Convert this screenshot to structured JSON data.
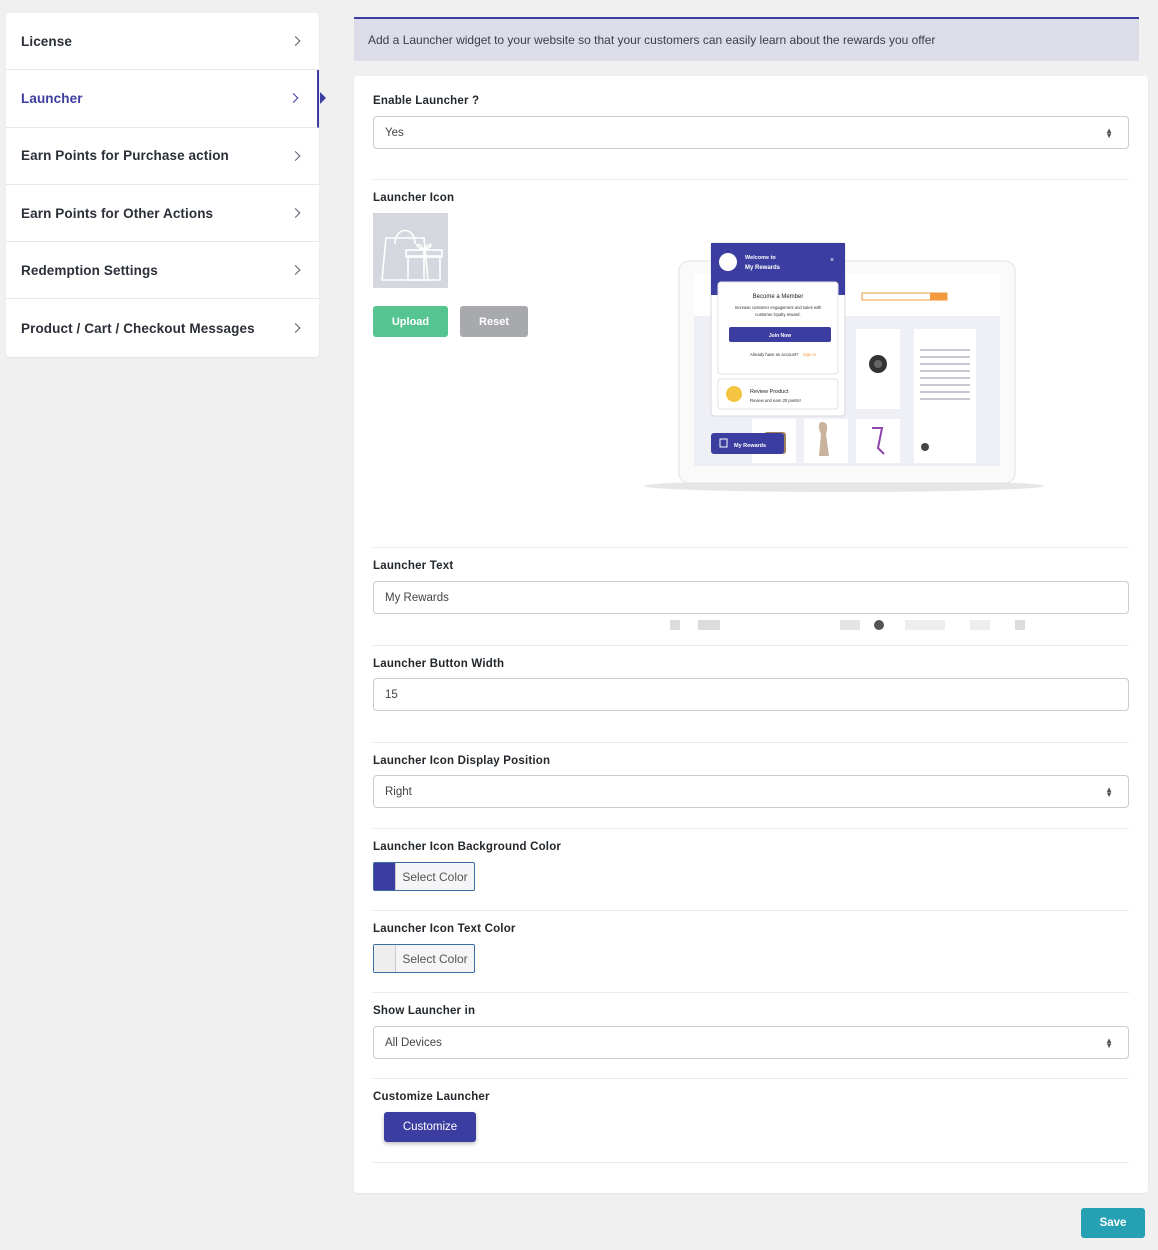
{
  "sidebar": {
    "items": [
      {
        "label": "License"
      },
      {
        "label": "Launcher"
      },
      {
        "label": "Earn Points for Purchase action"
      },
      {
        "label": "Earn Points for Other Actions"
      },
      {
        "label": "Redemption Settings"
      },
      {
        "label": "Product / Cart / Checkout Messages"
      }
    ]
  },
  "notice": "Add a Launcher widget to your website so that your customers can easily learn about the rewards you offer",
  "form": {
    "enable_launcher": {
      "label": "Enable Launcher ?",
      "value": "Yes"
    },
    "launcher_icon": {
      "label": "Launcher Icon",
      "upload_label": "Upload",
      "reset_label": "Reset"
    },
    "launcher_text": {
      "label": "Launcher Text",
      "value": "My Rewards"
    },
    "button_width": {
      "label": "Launcher Button Width",
      "value": "15"
    },
    "display_position": {
      "label": "Launcher Icon Display Position",
      "value": "Right"
    },
    "bg_color": {
      "label": "Launcher Icon Background Color",
      "button_label": "Select Color",
      "color": "#3b3ea0"
    },
    "text_color": {
      "label": "Launcher Icon Text Color",
      "button_label": "Select Color",
      "color": "#eeeeee"
    },
    "show_in": {
      "label": "Show Launcher in",
      "value": "All Devices"
    },
    "customize": {
      "label": "Customize Launcher",
      "button_label": "Customize"
    }
  },
  "preview": {
    "welcome_line1": "Welcome to",
    "welcome_line2": "My Rewards",
    "become_member": "Become a Member",
    "member_desc_line1": "Increase customer engagement and sales with",
    "member_desc_line2": "customer loyalty reward.",
    "join_now": "Join Now",
    "already_account": "Already have an account?",
    "sign_in": "Sign in",
    "review_title": "Review Product",
    "review_desc": "Review and earn 20 points!",
    "launcher_button": "My Rewards"
  },
  "save_label": "Save",
  "colors": {
    "accent": "#3b3ea0",
    "upload": "#55c491",
    "reset": "#a7a9ad",
    "save": "#26a0b3"
  }
}
